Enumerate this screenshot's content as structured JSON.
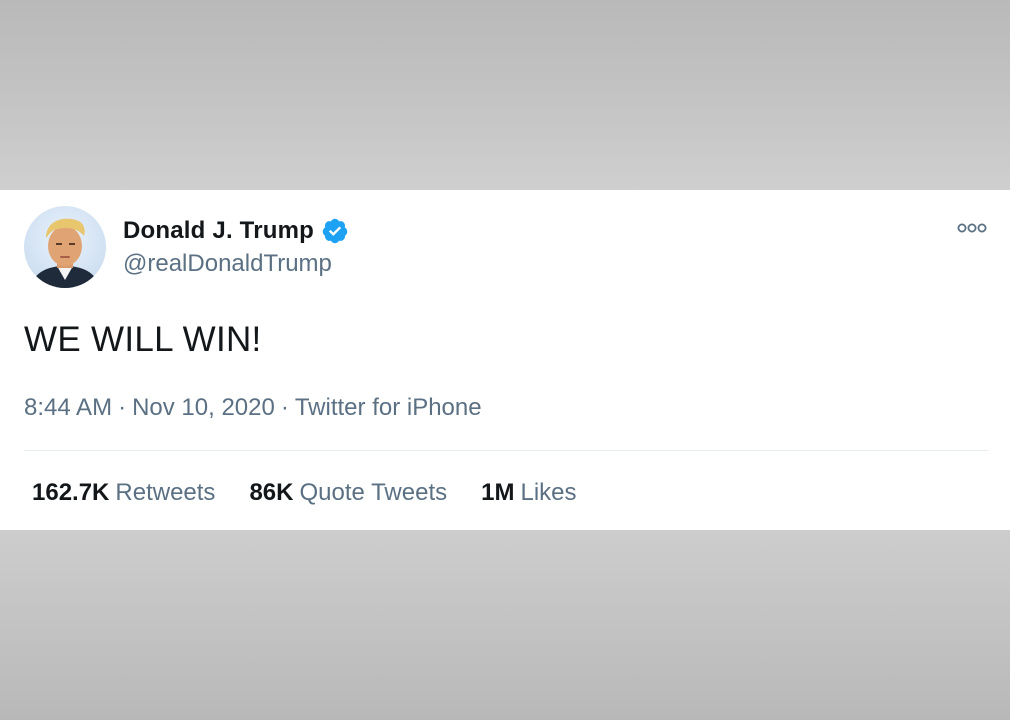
{
  "tweet": {
    "author": {
      "display_name": "Donald J. Trump",
      "handle": "@realDonaldTrump",
      "verified": true,
      "avatar_icon": "profile-photo"
    },
    "text": "WE WILL WIN!",
    "time": "8:44 AM",
    "date": "Nov 10, 2020",
    "separator": "·",
    "source": "Twitter for iPhone",
    "stats": [
      {
        "count": "162.7K",
        "label": "Retweets"
      },
      {
        "count": "86K",
        "label": "Quote Tweets"
      },
      {
        "count": "1M",
        "label": "Likes"
      }
    ]
  },
  "icons": {
    "verified": "verified-badge-icon",
    "more": "more-options-icon"
  },
  "colors": {
    "verified_blue": "#1da1f2",
    "text_primary": "#14171a",
    "text_secondary": "#5b7083",
    "card_background": "#ffffff"
  }
}
